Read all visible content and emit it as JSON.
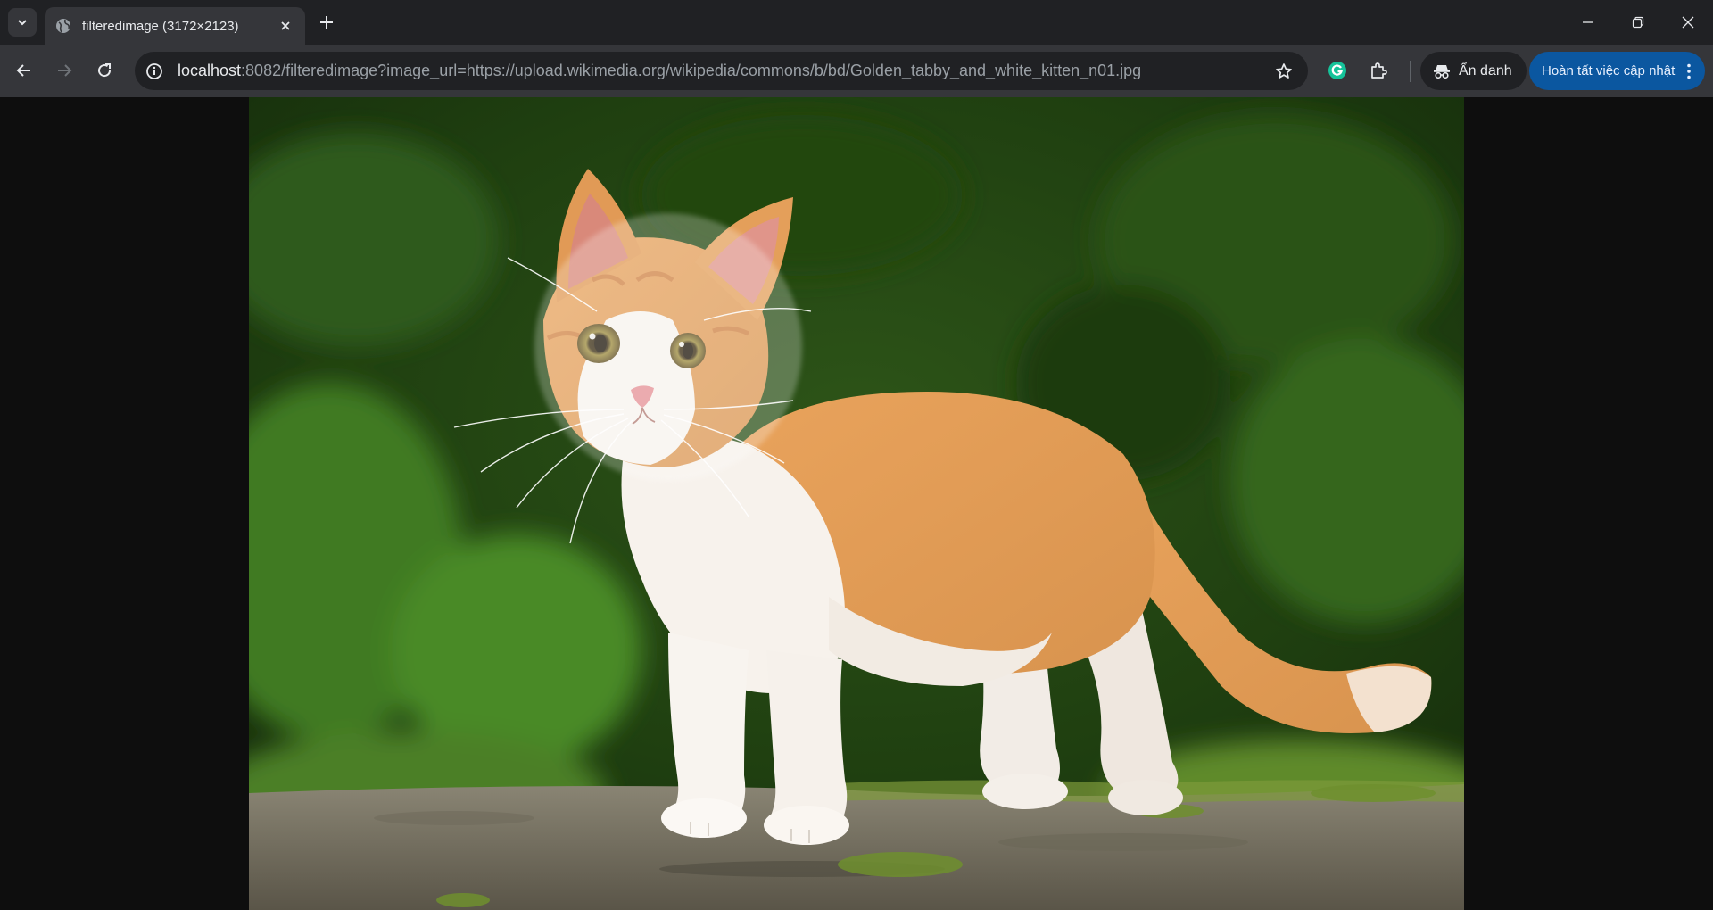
{
  "tab": {
    "title": "filteredimage (3172×2123)",
    "favicon": "globe-icon"
  },
  "address_bar": {
    "url_host": "localhost",
    "url_rest": ":8082/filteredimage?image_url=https://upload.wikimedia.org/wikipedia/commons/b/bd/Golden_tabby_and_white_kitten_n01.jpg"
  },
  "toolbar": {
    "incognito_label": "Ẩn danh",
    "update_label": "Hoàn tất việc cập nhật"
  },
  "image": {
    "alt": "Golden tabby and white kitten",
    "natural_width": 3172,
    "natural_height": 2123
  },
  "icons": [
    "tab-search-icon",
    "globe-icon",
    "close-icon",
    "plus-icon",
    "minimize-icon",
    "restore-icon",
    "window-close-icon",
    "back-icon",
    "forward-icon",
    "reload-icon",
    "info-icon",
    "star-icon",
    "grammarly-icon",
    "puzzle-icon",
    "incognito-icon",
    "kebab-menu-icon"
  ],
  "colors": {
    "tab_strip": "#202124",
    "toolbar": "#35363a",
    "accent_button": "#0b57a0",
    "page_background": "#0e0e0e"
  }
}
